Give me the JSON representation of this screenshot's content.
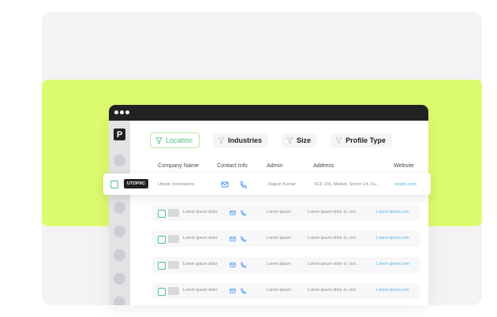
{
  "sidebar": {
    "logo_letter": "P"
  },
  "filters": [
    {
      "label": "Location",
      "active": true
    },
    {
      "label": "Industries",
      "active": false
    },
    {
      "label": "Size",
      "active": false
    },
    {
      "label": "Profile Type",
      "active": false
    }
  ],
  "table": {
    "headers": [
      "Company Name",
      "Contact Info",
      "Admin",
      "Address",
      "Website"
    ],
    "highlighted_row": {
      "logo_text": "UTOPIIC",
      "company": "Utopiic Innovations",
      "admin": "Rajesh Kumar",
      "address": "SCF 136, Market, Sector 14, Fa...",
      "website": "utopiic.com"
    },
    "rows": [
      {
        "company": "Lorem ipsum dolor",
        "admin": "Lorem ipsum",
        "address": "Lorem ipsum dolor si, con..",
        "website": "Lorem ipsum.com"
      },
      {
        "company": "Lorem ipsum dolor",
        "admin": "Lorem ipsum",
        "address": "Lorem ipsum dolor si, con..",
        "website": "Lorem ipsum.com"
      },
      {
        "company": "Lorem ipsum dolor",
        "admin": "Lorem ipsum",
        "address": "Lorem ipsum dolor si, con..",
        "website": "Lorem ipsum.com"
      },
      {
        "company": "Lorem ipsum dolor",
        "admin": "Lorem ipsum",
        "address": "Lorem ipsum dolor si, con..",
        "website": "Lorem ipsum.com"
      }
    ]
  },
  "colors": {
    "lime": "#dcfb6f",
    "accent_green": "#4fbf7e",
    "link_blue": "#4fb6e6",
    "titlebar": "#222222"
  },
  "icons": [
    "funnel-icon",
    "mail-icon",
    "phone-icon"
  ]
}
